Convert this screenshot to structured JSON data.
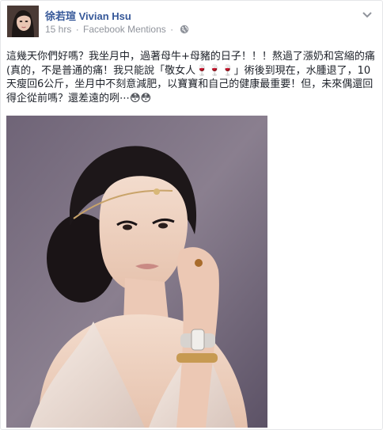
{
  "post": {
    "author": "徐若瑄 Vivian Hsu",
    "time": "15 hrs",
    "separator": "·",
    "source": "Facebook Mentions",
    "text": "這幾天你們好嗎？我坐月中，過著母牛+母豬的日子！！！熬過了漲奶和宮縮的痛(真的，不是普通的痛！我只能說「敬女人🍷🍷🍷」術後到現在，水腫退了，10天瘦回6公斤，坐月中不刻意減肥，以寶寶和自己的健康最重要！但，未來偶還回得企從前嗎？還差遠的咧⋯😳😳"
  },
  "icons": {
    "privacy": "globe-icon",
    "menu": "chevron-down-icon"
  }
}
